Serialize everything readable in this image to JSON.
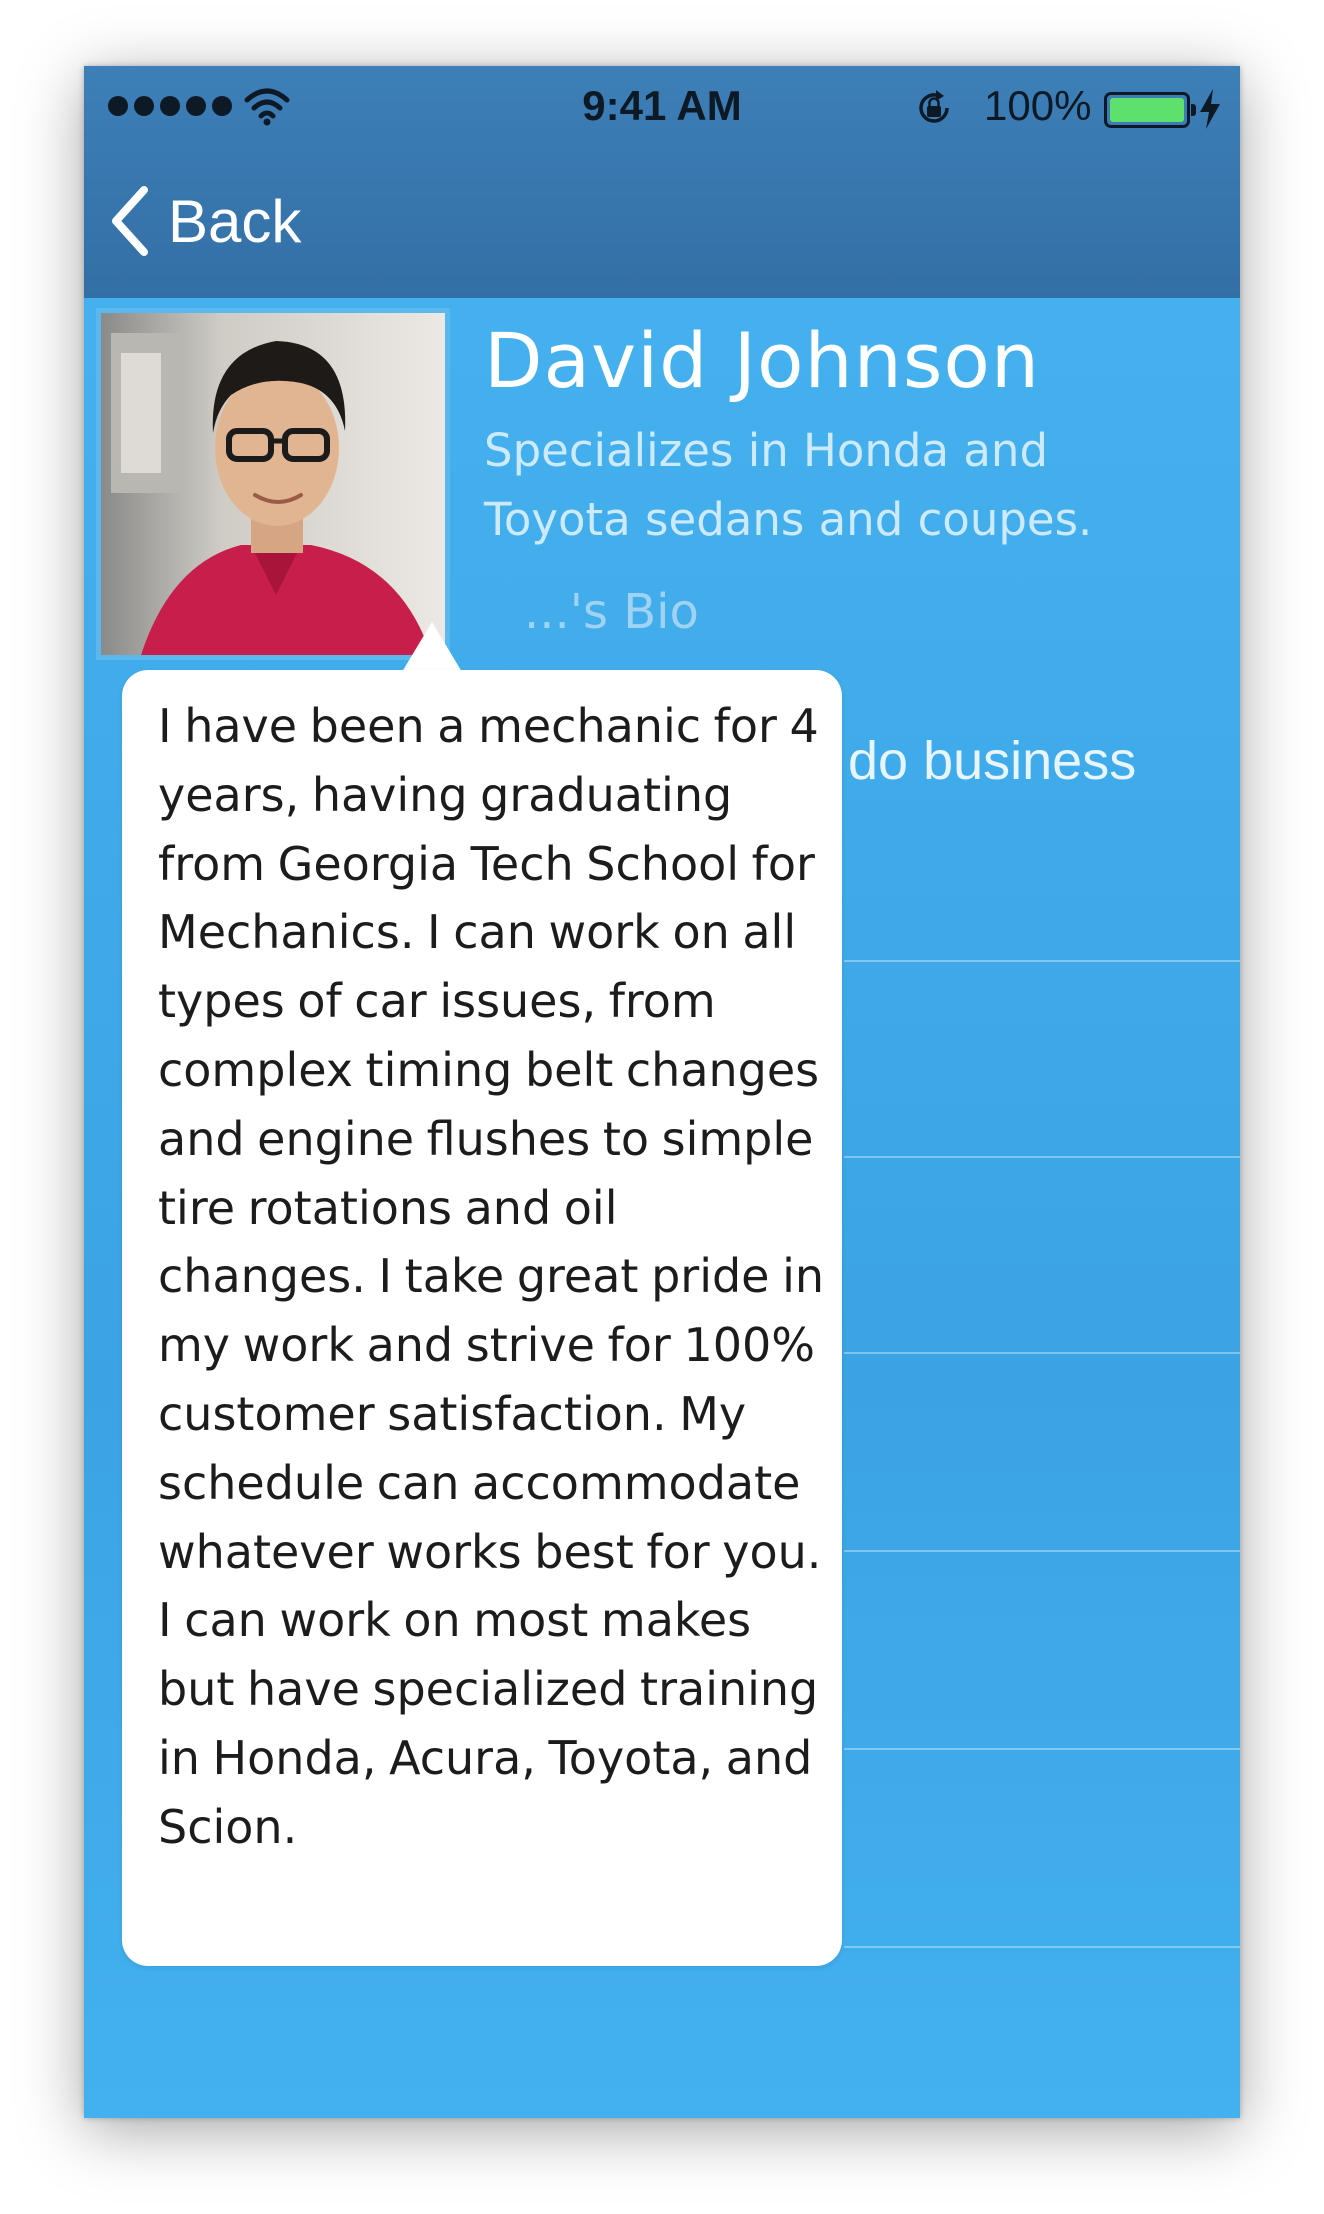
{
  "status_bar": {
    "time": "9:41 AM",
    "battery_percent": "100%",
    "signal_bars": 5,
    "icons": [
      "signal-dots-icon",
      "wifi-icon",
      "lock-rotation-icon",
      "battery-icon",
      "charging-icon"
    ],
    "battery_color": "#5ee06c"
  },
  "nav": {
    "back_label": "Back",
    "background_color": "#3670a8"
  },
  "profile": {
    "name": "David Johnson",
    "specialty": "Specializes in Honda and Toyota sedans and coupes.",
    "bio_link_partial": "...'s Bio",
    "business_text_partial": "do business"
  },
  "bio_popover": {
    "text": "I have been a mechanic for 4 years, having graduating from Georgia Tech School for Mechanics. I can work on all types of car issues, from complex timing belt changes and engine flushes to simple tire rotations and oil changes. I take great pride in my work and strive for 100% customer satisfaction. My schedule can accommodate whatever works best for you. I can work on most makes but have specialized training in Honda, Acura, Toyota, and Scion."
  },
  "colors": {
    "content_background": "#3ea9e8",
    "popover_background": "#ffffff",
    "text_on_blue": "#ffffff"
  }
}
